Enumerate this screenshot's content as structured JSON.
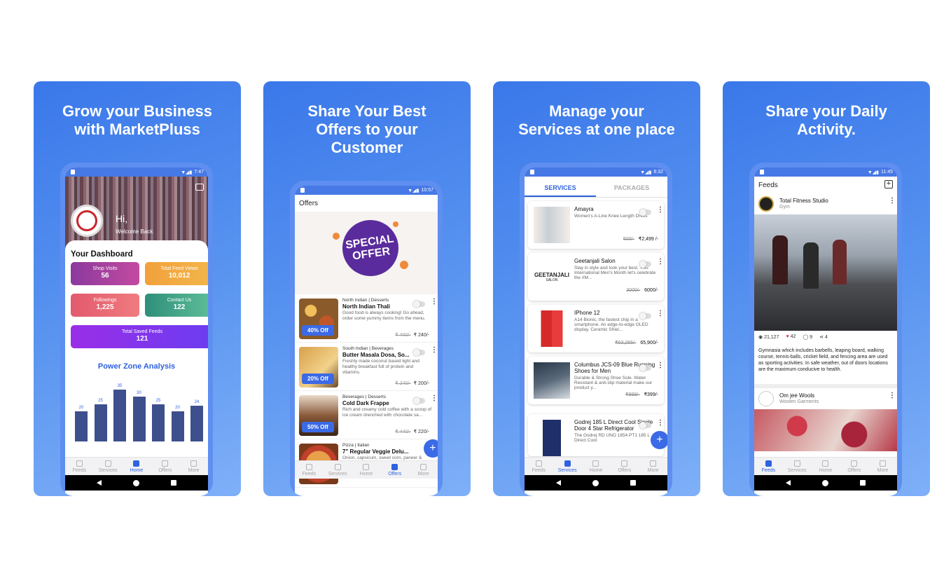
{
  "cards": [
    {
      "title": "Grow your Business\nwith MarketPluss"
    },
    {
      "title": "Share Your Best\nOffers to your\nCustomer"
    },
    {
      "title": "Manage your\nServices at one place"
    },
    {
      "title": "Share your Daily\nActivity."
    }
  ],
  "phone1": {
    "time": "7:47",
    "greeting": "Hi,",
    "welcome": "Welcome Back",
    "dashboard_title": "Your Dashboard",
    "tiles": [
      {
        "label": "Shop Visits",
        "value": "56"
      },
      {
        "label": "Total Feed Views",
        "value": "10,012"
      },
      {
        "label": "Followings",
        "value": "1,225"
      },
      {
        "label": "Contact Us",
        "value": "122"
      },
      {
        "label": "Total Saved Feeds",
        "value": "121"
      }
    ],
    "chart_title": "Power Zone Analysis",
    "chart_data": {
      "type": "bar",
      "values": [
        20,
        25,
        35,
        30,
        25,
        20,
        24
      ],
      "ylim": [
        0,
        40
      ]
    }
  },
  "nav": {
    "feeds": "Feeds",
    "services": "Services",
    "home": "Home",
    "offers": "Offers",
    "more": "More"
  },
  "phone2": {
    "time": "10:57",
    "header": "Offers",
    "banner_text": "SPECIAL OFFER",
    "items": [
      {
        "category": "North Indian | Desserts",
        "name": "North Indian Thali",
        "desc": "Good food is always cooking! Go ahead, order some yummy items from the menu.",
        "old_price": "₹ 400/-",
        "price": "₹ 240/-",
        "badge": "40% Off"
      },
      {
        "category": "South Indian | Beverages",
        "name": "Butter Masala Dosa, So...",
        "desc": "Freshly made coconut based light and healthy breakfast full of protein and vitamins.",
        "old_price": "₹ 240/-",
        "price": "₹ 200/-",
        "badge": "20% Off"
      },
      {
        "category": "Beverages | Desserts",
        "name": "Cold Dark Frappe",
        "desc": "Rich and creamy cold coffee with a scoop of ice cream drenched with chocolate sa...",
        "old_price": "₹ 440/-",
        "price": "₹ 220/-",
        "badge": "50% Off"
      },
      {
        "category": "Pizza | Italian",
        "name": "7\" Regular Veggie Delu...",
        "desc": "Onion, capsicum, sweet corn, paneer & mushroom"
      }
    ]
  },
  "phone3": {
    "time": "6:32",
    "tab_services": "SERVICES",
    "tab_packages": "PACKAGES",
    "items": [
      {
        "name": "Amayra",
        "desc": "Women's A-Line Knee Length Dress",
        "old_price": "600/-",
        "price": "₹2,499 /-"
      },
      {
        "name": "Geetanjali Salon",
        "desc": "Stay in style and look your best. This International Men's Month let's celebrate the #M...",
        "old_price": "3000/-",
        "price": "6000/-",
        "logo": "GEETANJALI",
        "logo_sub": "SALON"
      },
      {
        "name": "IPhone 12",
        "desc": "A14 Bionic, the fastest chip in a smartphone. An edge-to-edge OLED display. Ceramic Shiel...",
        "old_price": "₹63,265/-",
        "price": "65,900/-"
      },
      {
        "name": "Columbus JCS-09 Blue Running Shoes for Men",
        "desc": "Durable & Strong Shoe Sole. Water Resistant & anti-slip material make our product y...",
        "old_price": "₹999/-",
        "price": "₹399/-"
      },
      {
        "name": "Godrej 185 L Direct Cool Single Door 4 Star Refrigerator",
        "desc": "The Godrej RD UNO 1854 PT1 185 L Direct Cool"
      }
    ]
  },
  "phone4": {
    "time": "11:45",
    "header": "Feeds",
    "post1": {
      "name": "Total Fitness Studio",
      "sub": "Gym",
      "views": "21,127",
      "likes": "42",
      "comments": "9",
      "shares": "4",
      "text": "Gymnasia which includes barbells, leaping board, walking course, tennis-balls, cricket field, and fencing area are used as sporting activities. In safe weather, out of doors locations are the maximum conducive to health."
    },
    "post2": {
      "name": "Om jee Wools",
      "sub": "Woolen Garments"
    }
  },
  "colors": {
    "accent": "#2e62e0",
    "badge": "#3b6ae6"
  }
}
